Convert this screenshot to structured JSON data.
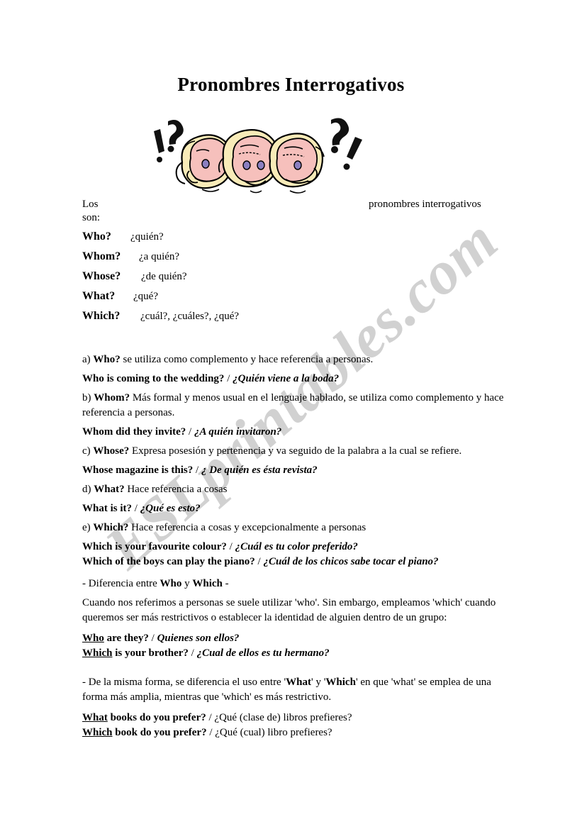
{
  "document": {
    "title": "Pronombres Interrogativos",
    "watermark": "ESLprintables.com",
    "intro": {
      "left_line1": "Los",
      "left_line2": "son:",
      "right": "pronombres interrogativos"
    },
    "illustration": {
      "name": "three-confused-faces",
      "description": "Three cartoon faces with blonde hair and pink skin surrounded by question and exclamation marks",
      "colors": {
        "hair": "#f8ebb8",
        "skin": "#f6c0bc",
        "outline": "#000000",
        "eye": "#8b7fc0"
      }
    },
    "pronoun_list": [
      {
        "en": "Who?",
        "es": "¿quién?"
      },
      {
        "en": "Whom?",
        "es": "¿a quién?"
      },
      {
        "en": "Whose?",
        "es": "¿de quién?"
      },
      {
        "en": "What?",
        "es": "¿qué?"
      },
      {
        "en": "Which?",
        "es": "¿cuál?, ¿cuáles?, ¿qué?"
      }
    ],
    "sections": {
      "a": {
        "marker": "a)",
        "term": "Who?",
        "text": " se utiliza como complemento y hace referencia a personas.",
        "example_en": "Who is coming to the wedding?",
        "example_sep": " / ",
        "example_es": "¿Quién viene a la boda?"
      },
      "b": {
        "marker": "b)",
        "term": "Whom?",
        "text": " Más formal y menos usual en el lenguaje hablado, se utiliza como complemento y hace referencia a personas.",
        "example_en": "Whom did they invite?",
        "example_sep": " / ",
        "example_es": "¿A quién invitaron?"
      },
      "c": {
        "marker": "c)",
        "term": "Whose?",
        "text": " Expresa posesión y pertenencia y va seguido de la palabra a la cual se refiere.",
        "example_en": "Whose magazine is this?",
        "example_sep": " / ",
        "example_es": "¿ De quién es ésta revista?"
      },
      "d": {
        "marker": "d)",
        "term": "What?",
        "text": " Hace referencia a cosas",
        "example_en": "What is it?",
        "example_sep": " / ",
        "example_es": "¿Qué es esto?"
      },
      "e": {
        "marker": "e)",
        "term": "Which?",
        "text": " Hace referencia a cosas y excepcionalmente a personas",
        "example1_en": "Which is your favourite colour?",
        "example1_sep": " / ",
        "example1_es": "¿Cuál es tu color preferido?",
        "example2_en": "Which of the boys can play the piano?",
        "example2_sep": " / ",
        "example2_es": "¿Cuál de los chicos sabe tocar el piano?"
      }
    },
    "difference_who_which": {
      "heading_pre": "- Diferencia entre ",
      "heading_term1": "Who",
      "heading_mid": " y ",
      "heading_term2": "Which",
      "heading_post": " -",
      "paragraph": "Cuando nos referimos a personas se suele utilizar 'who'. Sin embargo, empleamos 'which' cuando queremos ser más restrictivos o establecer la identidad de alguien dentro de un grupo:",
      "example1_u": "Who",
      "example1_en": " are they?",
      "example1_sep": " / ",
      "example1_es": "Quienes son ellos?",
      "example2_u": "Which",
      "example2_en": " is your brother?",
      "example2_sep": " / ",
      "example2_es": "¿Cual de ellos es tu hermano?"
    },
    "difference_what_which": {
      "para_pre": "- De la misma forma, se diferencia el uso entre '",
      "para_term1": "What",
      "para_mid": "' y '",
      "para_term2": "Which",
      "para_post": "' en que 'what' se emplea de una forma más amplia, mientras que 'which' es más restrictivo.",
      "example1_u": "What",
      "example1_en": " books do you prefer?",
      "example1_sep": " / ",
      "example1_es": "¿Qué (clase de) libros prefieres?",
      "example2_u": "Which",
      "example2_en": " book do you prefer?",
      "example2_sep": " / ",
      "example2_es": "¿Qué (cual) libro prefieres?"
    }
  }
}
